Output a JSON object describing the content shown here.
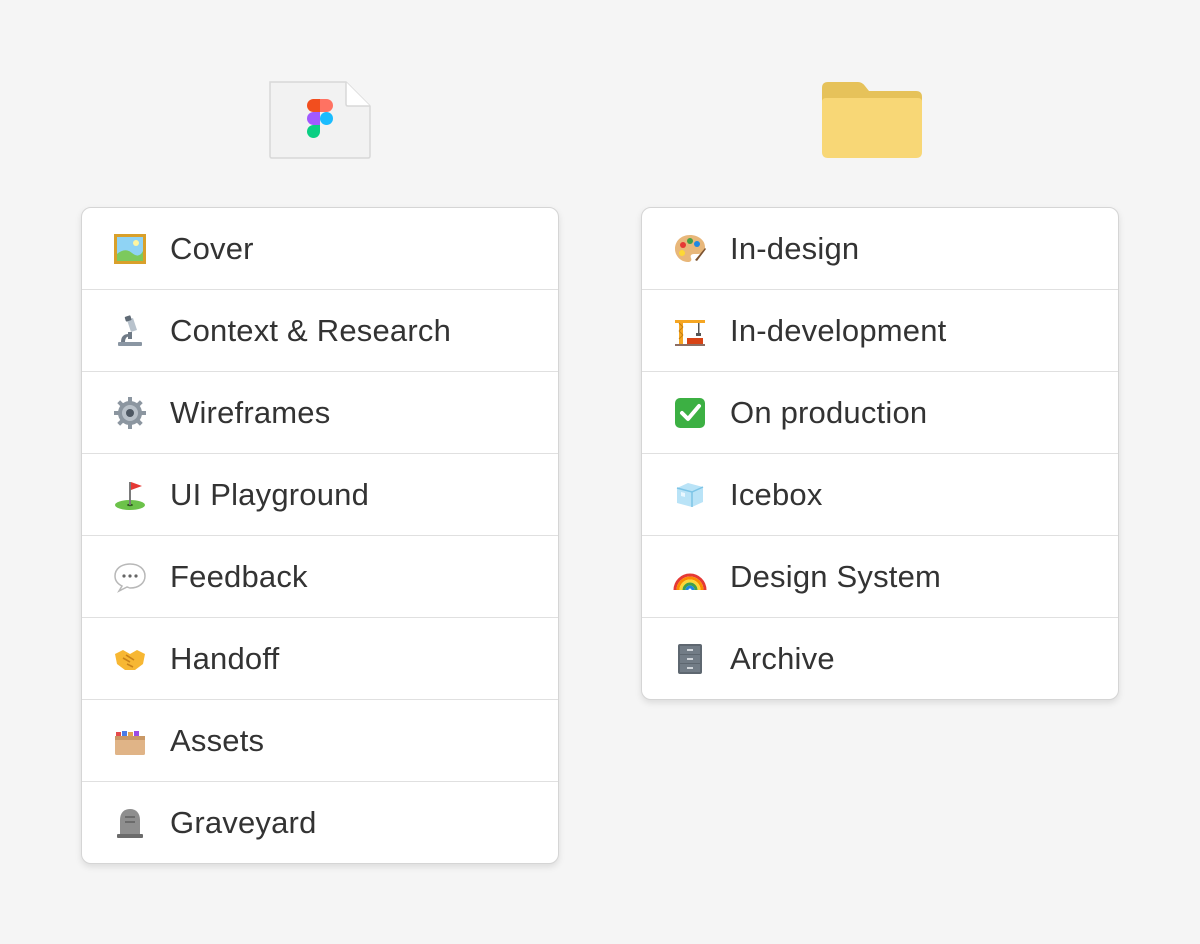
{
  "colors": {
    "background": "#f5f5f5",
    "card": "#ffffff",
    "border": "#d5d5d5",
    "text": "#333333",
    "folder": "#f6d56d"
  },
  "file_panel": {
    "icon": "figma-file-icon",
    "items": [
      {
        "label": "Cover",
        "icon": "framed-picture-icon"
      },
      {
        "label": "Context & Research",
        "icon": "microscope-icon"
      },
      {
        "label": "Wireframes",
        "icon": "gear-icon"
      },
      {
        "label": "UI Playground",
        "icon": "golf-flag-icon"
      },
      {
        "label": "Feedback",
        "icon": "speech-balloon-icon"
      },
      {
        "label": "Handoff",
        "icon": "handshake-icon"
      },
      {
        "label": "Assets",
        "icon": "card-file-box-icon"
      },
      {
        "label": "Graveyard",
        "icon": "headstone-icon"
      }
    ]
  },
  "folder_panel": {
    "icon": "folder-icon",
    "items": [
      {
        "label": "In-design",
        "icon": "artist-palette-icon"
      },
      {
        "label": "In-development",
        "icon": "construction-crane-icon"
      },
      {
        "label": "On production",
        "icon": "check-mark-button-icon"
      },
      {
        "label": "Icebox",
        "icon": "ice-cube-icon"
      },
      {
        "label": "Design System",
        "icon": "rainbow-icon"
      },
      {
        "label": "Archive",
        "icon": "file-cabinet-icon"
      }
    ]
  }
}
